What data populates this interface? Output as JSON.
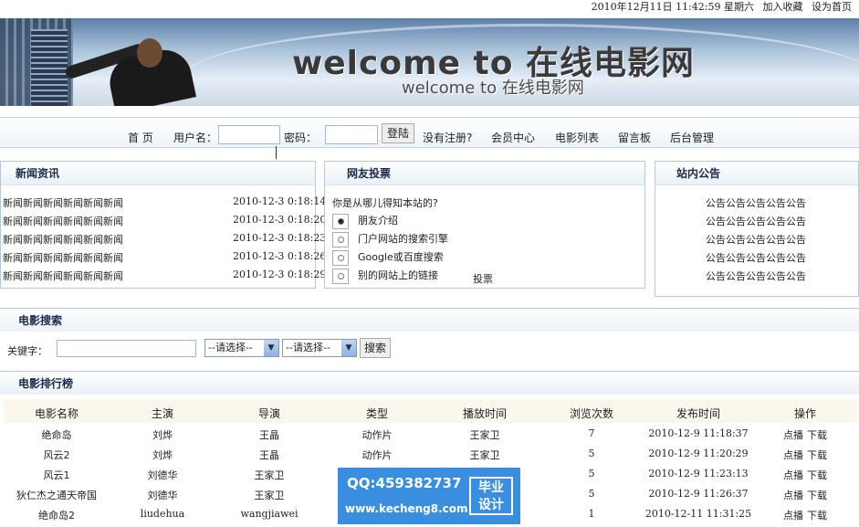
{
  "topbar": {
    "datetime": "2010年12月11日 11:42:59 星期六",
    "bookmark": "加入收藏",
    "homepage": "设为首页"
  },
  "banner": {
    "title": "welcome to 在线电影网",
    "subtitle": "welcome to 在线电影网"
  },
  "nav": {
    "home": "首 页",
    "username_label": "用户名：",
    "password_label": "密码：",
    "login": "登陆",
    "register": "没有注册?",
    "member": "会员中心",
    "movie_list": "电影列表",
    "guestbook": "留言板",
    "admin": "后台管理"
  },
  "news": {
    "title": "新闻资讯",
    "items": [
      {
        "title": "新闻新闻新闻新闻新闻新闻",
        "date": "2010-12-3 0:18:14"
      },
      {
        "title": "新闻新闻新闻新闻新闻新闻",
        "date": "2010-12-3 0:18:20"
      },
      {
        "title": "新闻新闻新闻新闻新闻新闻",
        "date": "2010-12-3 0:18:23"
      },
      {
        "title": "新闻新闻新闻新闻新闻新闻",
        "date": "2010-12-3 0:18:26"
      },
      {
        "title": "新闻新闻新闻新闻新闻新闻",
        "date": "2010-12-3 0:18:29"
      }
    ]
  },
  "vote": {
    "title": "网友投票",
    "question": "你是从哪儿得知本站的?",
    "options": [
      {
        "label": "朋友介绍",
        "checked": true
      },
      {
        "label": "门户网站的搜索引擎",
        "checked": false
      },
      {
        "label": "Google或百度搜索",
        "checked": false
      },
      {
        "label": "别的网站上的链接",
        "checked": false
      }
    ],
    "submit": "投票"
  },
  "notice": {
    "title": "站内公告",
    "items": [
      "公告公告公告公告公告",
      "公告公告公告公告公告",
      "公告公告公告公告公告",
      "公告公告公告公告公告",
      "公告公告公告公告公告"
    ]
  },
  "search": {
    "title": "电影搜索",
    "keyword_label": "关键字：",
    "keyword_value": "",
    "select1": "--请选择--",
    "select2": "--请选择--",
    "button": "搜索"
  },
  "ranking": {
    "title": "电影排行榜",
    "columns": [
      "电影名称",
      "主演",
      "导演",
      "类型",
      "播放时间",
      "浏览次数",
      "发布时间",
      "操作"
    ],
    "rows": [
      {
        "name": "绝命岛",
        "actor": "刘烨",
        "director": "王晶",
        "type": "动作片",
        "play": "王家卫",
        "views": "7",
        "date": "2010-12-9 11:18:37",
        "op_play": "点播",
        "op_download": "下载"
      },
      {
        "name": "风云2",
        "actor": "刘烨",
        "director": "王晶",
        "type": "动作片",
        "play": "王家卫",
        "views": "5",
        "date": "2010-12-9 11:20:29",
        "op_play": "点播",
        "op_download": "下载"
      },
      {
        "name": "风云1",
        "actor": "刘德华",
        "director": "王家卫",
        "type": "",
        "play": "",
        "views": "5",
        "date": "2010-12-9 11:23:13",
        "op_play": "点播",
        "op_download": "下载"
      },
      {
        "name": "狄仁杰之通天帝国",
        "actor": "刘德华",
        "director": "王家卫",
        "type": "",
        "play": "",
        "views": "5",
        "date": "2010-12-9 11:26:37",
        "op_play": "点播",
        "op_download": "下载"
      },
      {
        "name": "绝命岛2",
        "actor": "liudehua",
        "director": "wangjiawei",
        "type": "",
        "play": "",
        "views": "1",
        "date": "2010-12-11 11:31:25",
        "op_play": "点播",
        "op_download": "下载"
      }
    ]
  },
  "watermark": {
    "qq": "QQ:459382737",
    "url": "www.kecheng8.com",
    "tag_line1": "毕业",
    "tag_line2": "设计"
  }
}
